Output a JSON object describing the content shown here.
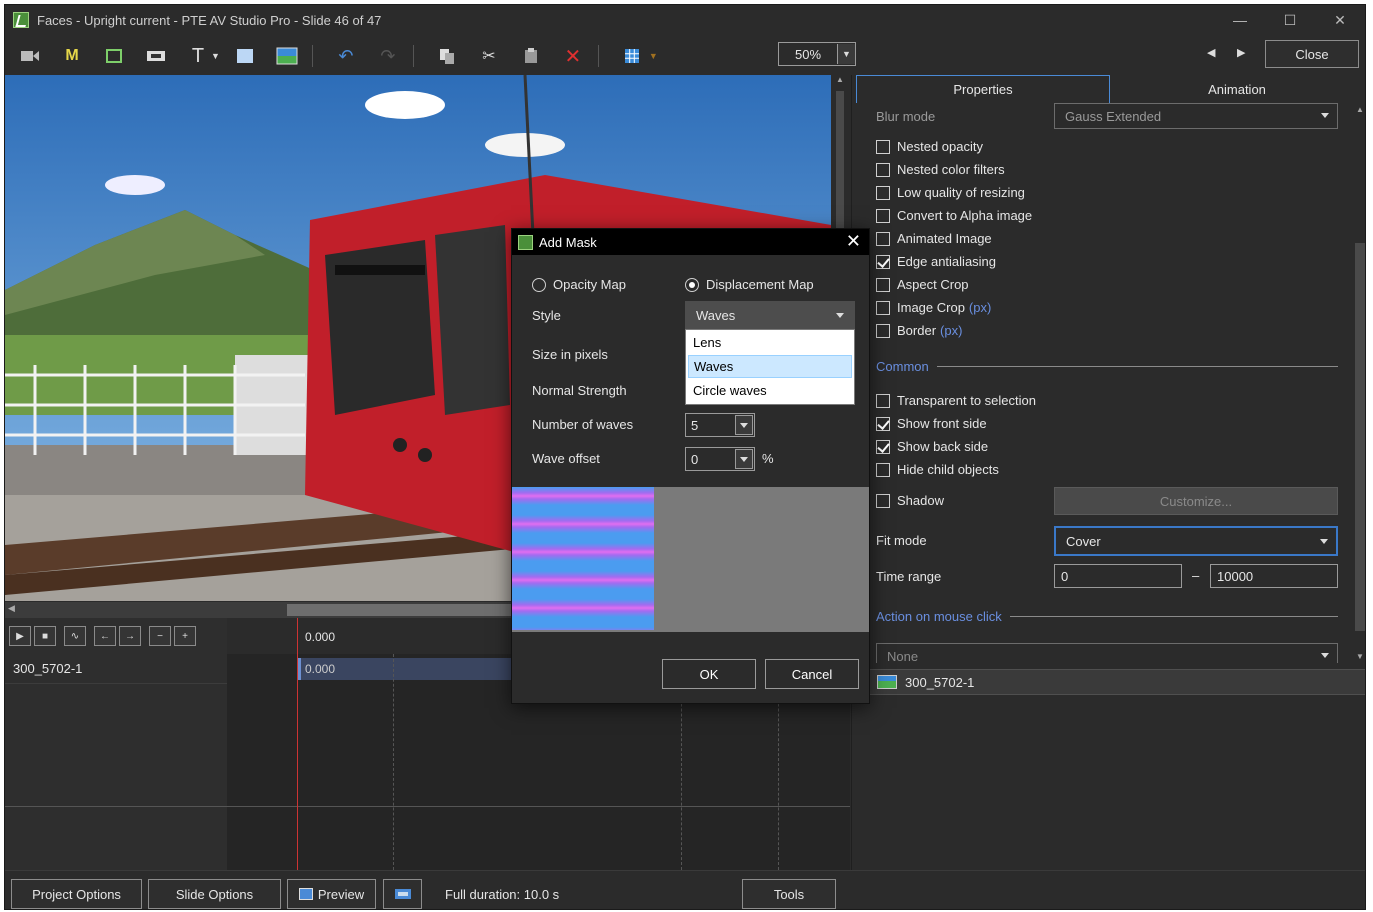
{
  "window": {
    "title": "Faces - Upright current - PTE AV Studio Pro - Slide 46 of 47"
  },
  "toolbar": {
    "zoom": "50%",
    "close_label": "Close"
  },
  "timeline": {
    "ruler_time": "0.000",
    "track_name": "300_5702-1",
    "clip_time": "0.000"
  },
  "bottombar": {
    "project_options": "Project Options",
    "slide_options": "Slide Options",
    "preview": "Preview",
    "duration": "Full duration: 10.0 s",
    "tools": "Tools"
  },
  "panel": {
    "tabs": {
      "properties": "Properties",
      "animation": "Animation"
    },
    "blur_mode_label": "Blur mode",
    "blur_mode_value": "Gauss Extended",
    "checkboxes": [
      {
        "label": "Nested opacity",
        "checked": false
      },
      {
        "label": "Nested color filters",
        "checked": false
      },
      {
        "label": "Low quality of resizing",
        "checked": false
      },
      {
        "label": "Convert to Alpha image",
        "checked": false
      },
      {
        "label": "Animated Image",
        "checked": false
      },
      {
        "label": "Edge antialiasing",
        "checked": true
      },
      {
        "label": "Aspect Crop",
        "checked": false
      },
      {
        "label": "Image Crop",
        "checked": false,
        "suffix": "(px)"
      },
      {
        "label": "Border",
        "checked": false,
        "suffix": "(px)"
      }
    ],
    "common_section": "Common",
    "common_checkboxes": [
      {
        "label": "Transparent to selection",
        "checked": false
      },
      {
        "label": "Show front side",
        "checked": true
      },
      {
        "label": "Show back side",
        "checked": true
      },
      {
        "label": "Hide child objects",
        "checked": false
      }
    ],
    "shadow_label": "Shadow",
    "customize_label": "Customize...",
    "fit_mode_label": "Fit mode",
    "fit_mode_value": "Cover",
    "time_range_label": "Time range",
    "time_range_from": "0",
    "time_range_dash": "–",
    "time_range_to": "10000",
    "action_section": "Action on mouse click",
    "action_value": "None",
    "object_name": "300_5702-1"
  },
  "dialog": {
    "title": "Add Mask",
    "opacity_map": "Opacity Map",
    "displacement_map": "Displacement Map",
    "style_label": "Style",
    "style_value": "Waves",
    "style_options": [
      "Lens",
      "Waves",
      "Circle waves"
    ],
    "size_label": "Size in pixels",
    "strength_label": "Normal Strength",
    "waves_label": "Number of waves",
    "waves_value": "5",
    "offset_label": "Wave offset",
    "offset_value": "0",
    "offset_unit": "%",
    "ok": "OK",
    "cancel": "Cancel"
  },
  "colors": {
    "accent": "#4a8ad6",
    "link": "#6a8fe0",
    "background": "#2b2b2b"
  }
}
